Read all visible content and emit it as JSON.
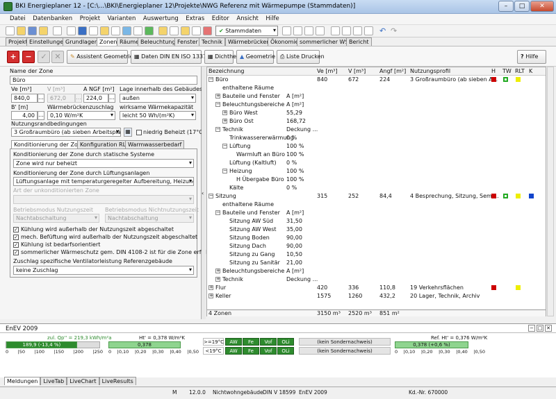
{
  "window": {
    "title": "BKI Energieplaner 12 - [C:\\...\\BKI\\Energieplaner 12\\Projekte\\NWG Referenz mit Wärmepumpe (Stammdaten)]"
  },
  "menu": [
    "Datei",
    "Datenbanken",
    "Projekt",
    "Varianten",
    "Auswertung",
    "Extras",
    "Editor",
    "Ansicht",
    "Hilfe"
  ],
  "toolbar": {
    "variant": "Stammdaten"
  },
  "tabs": [
    "Projekt",
    "Einstellungen",
    "Grundlagen",
    "Zonen",
    "Räume",
    "Beleuchtung",
    "Fenster",
    "Technik",
    "Wärmebrücken",
    "Ökonomie",
    "sommerlicher WS",
    "Bericht"
  ],
  "active_tab": "Zonen",
  "actions": {
    "add": "+",
    "remove": "−",
    "assistent": "Assistent Geometrie",
    "daten": "Daten DIN EN ISO 13370",
    "dichtheit": "Dichtheit",
    "geometrie": "Geometrie",
    "liste": "Liste Drucken",
    "hilfe": "Hilfe"
  },
  "form": {
    "name_label": "Name der Zone",
    "name": "Büro",
    "ve_label": "Ve [m³]",
    "v_label": "V [m³]",
    "angf_label": "A NGF [m²]",
    "lage_label": "Lage innerhalb des Gebäudes",
    "ve": "840,0",
    "v": "672,0",
    "angf": "224,0",
    "lage": "außen",
    "b_label": "B' [m]",
    "wbz_label": "Wärmebrückenzuschlag",
    "wwk_label": "wirksame Wärmekapazität",
    "b": "4,00",
    "wbz": "0,10 W/m²K",
    "wwk": "leicht 50 Wh/(m²K)",
    "nutz_label": "Nutzungsrandbedingungen",
    "nutz": "3 Großraumbüro (ab sieben Arbeitsplätze)",
    "niedrig": "niedrig Beheizt (17°C)"
  },
  "innertabs": [
    "Konditionierung der Zone",
    "Konfiguration RLT",
    "Warmwasserbedarf"
  ],
  "kond": {
    "stat_label": "Konditionierung der Zone durch statische Systeme",
    "stat": "Zone wird nur beheizt",
    "luft_label": "Konditionierung der Zone durch Lüftungsanlagen",
    "luft": "Lüftungsanlage mit temperaturgeregelter Aufbereitung, Heizung",
    "art_label": "Art der unkonditionierten Zone",
    "art": "",
    "bmn_label": "Betriebsmodus Nutzungszeit",
    "bmnn_label": "Betriebsmodus Nichtnutzungszeit",
    "bmn": "Nachtabschaltung",
    "bmnn": "Nachtabschaltung",
    "checks": [
      "Kühlung wird außerhalb der Nutzungszeit abgeschaltet",
      "mech. Befüftung wird außerhalb der Nutzungszeit abgeschaltet",
      "Kühlung ist bedarfsorientiert",
      "sommerlicher Wärmeschutz gem. DIN 4108-2 ist für die Zone erfüllt"
    ],
    "zuschlag_label": "Zuschlag spezifische Ventilatorleistung Referenzgebäude",
    "zuschlag": "keine Zuschlag"
  },
  "tree": {
    "headers": [
      "Bezeichnung",
      "Ve [m³]",
      "V [m³]",
      "Angf [m²]",
      "Nutzungsprofil",
      "H",
      "TW",
      "RLT",
      "K"
    ],
    "rows": [
      {
        "indent": 0,
        "exp": "−",
        "name": "Büro",
        "ve": "840",
        "v": "672",
        "angf": "224",
        "profil": "3 Großraumbüro (ab sieben A...",
        "marks": [
          "#cc0000",
          "#22aa22",
          "#eeee00",
          ""
        ]
      },
      {
        "indent": 1,
        "exp": "",
        "name": "enthaltene Räume",
        "col2": ""
      },
      {
        "indent": 1,
        "exp": "+",
        "name": "Bauteile und Fenster",
        "col2": "A [m²]"
      },
      {
        "indent": 1,
        "exp": "−",
        "name": "Beleuchtungsbereiche",
        "col2": "A [m²]"
      },
      {
        "indent": 2,
        "exp": "+",
        "name": "Büro West",
        "col2": "55,29"
      },
      {
        "indent": 2,
        "exp": "+",
        "name": "Büro Ost",
        "col2": "168,72"
      },
      {
        "indent": 1,
        "exp": "−",
        "name": "Technik",
        "col2": "Deckung ..."
      },
      {
        "indent": 2,
        "exp": "",
        "name": "Trinkwassererwärmung",
        "col2": "0 %"
      },
      {
        "indent": 2,
        "exp": "−",
        "name": "Lüftung",
        "col2": "100 %"
      },
      {
        "indent": 3,
        "exp": "",
        "name": "Warmluft an Büro",
        "col2": "100 %"
      },
      {
        "indent": 2,
        "exp": "",
        "name": "Lüftung (Kaltluft)",
        "col2": "0 %"
      },
      {
        "indent": 2,
        "exp": "−",
        "name": "Heizung",
        "col2": "100 %"
      },
      {
        "indent": 3,
        "exp": "",
        "name": "H Übergabe Büro",
        "col2": "100 %"
      },
      {
        "indent": 2,
        "exp": "",
        "name": "Kälte",
        "col2": "0 %"
      },
      {
        "indent": 0,
        "exp": "−",
        "name": "Sitzung",
        "ve": "315",
        "v": "252",
        "angf": "84,4",
        "profil": "4 Besprechung, Sitzung, Semi...",
        "marks": [
          "#cc0000",
          "#22aa22",
          "#eeee00",
          "#1144cc"
        ]
      },
      {
        "indent": 1,
        "exp": "",
        "name": "enthaltene Räume",
        "col2": ""
      },
      {
        "indent": 1,
        "exp": "−",
        "name": "Bauteile und Fenster",
        "col2": "A [m²]"
      },
      {
        "indent": 2,
        "exp": "",
        "name": "Sitzung AW Süd",
        "col2": "31,50"
      },
      {
        "indent": 2,
        "exp": "",
        "name": "Sitzung AW West",
        "col2": "35,00"
      },
      {
        "indent": 2,
        "exp": "",
        "name": "Sitzung Boden",
        "col2": "90,00"
      },
      {
        "indent": 2,
        "exp": "",
        "name": "Sitzung Dach",
        "col2": "90,00"
      },
      {
        "indent": 2,
        "exp": "",
        "name": "Sitzung zu Gang",
        "col2": "10,50"
      },
      {
        "indent": 2,
        "exp": "",
        "name": "Sitzung zu Sanitär",
        "col2": "21,00"
      },
      {
        "indent": 1,
        "exp": "+",
        "name": "Beleuchtungsbereiche",
        "col2": "A [m²]"
      },
      {
        "indent": 1,
        "exp": "+",
        "name": "Technik",
        "col2": "Deckung ..."
      },
      {
        "indent": 0,
        "exp": "+",
        "name": "Flur",
        "ve": "420",
        "v": "336",
        "angf": "110,8",
        "profil": "19 Verkehrsflächen",
        "marks": [
          "#cc0000",
          "",
          "#eeee00",
          ""
        ]
      },
      {
        "indent": 0,
        "exp": "+",
        "name": "Keller",
        "ve": "1575",
        "v": "1260",
        "angf": "432,2",
        "profil": "20 Lager, Technik, Archiv",
        "marks": [
          "",
          "",
          "",
          ""
        ]
      }
    ],
    "footer": {
      "count": "4 Zonen",
      "ve": "3150 m³",
      "v": "2520 m³",
      "angf": "851 m²"
    }
  },
  "enev": {
    "title": "EnEV 2009",
    "qp_label": "zul. Qp'' = 219,3 kWh/m²a",
    "qp_bar": "189,9 (-13,4 %)",
    "qp_fill": 0.76,
    "qp_ticks": [
      "0",
      "|50",
      "|100",
      "|150",
      "|200",
      "|250"
    ],
    "ht_label": "Ht' = 0,378 W/m²K",
    "ht_bar": "0,378",
    "ht_ticks": [
      "0",
      "|0,10",
      "|0,20",
      "|0,30",
      "|0,40",
      "|0,50"
    ],
    "rows": [
      {
        "temp": ">=19°C",
        "cells": [
          "AW",
          "Fe",
          "Vof",
          "OLi"
        ],
        "sonder": "(kein Sondernachweis)"
      },
      {
        "temp": "<19°C",
        "cells": [
          "AW",
          "Fe",
          "Vof",
          "OLi"
        ],
        "sonder": "(kein Sondernachweis)"
      }
    ],
    "ref_label": "Ref. Ht' = 0,376 W/m²K",
    "ref_bar": "0,378 (+0,6 %)",
    "ref_ticks": [
      "0",
      "|0,10",
      "|0,20",
      "|0,30",
      "|0,40",
      "|0,50"
    ]
  },
  "bottomtabs": [
    "Meldungen",
    "LiveTab",
    "LiveChart",
    "LiveResults"
  ],
  "status": [
    "M",
    "12.0.0",
    "Nichtwohngebäude",
    "DIN V 18599",
    "EnEV 2009",
    "Kd.-Nr. 670000"
  ]
}
